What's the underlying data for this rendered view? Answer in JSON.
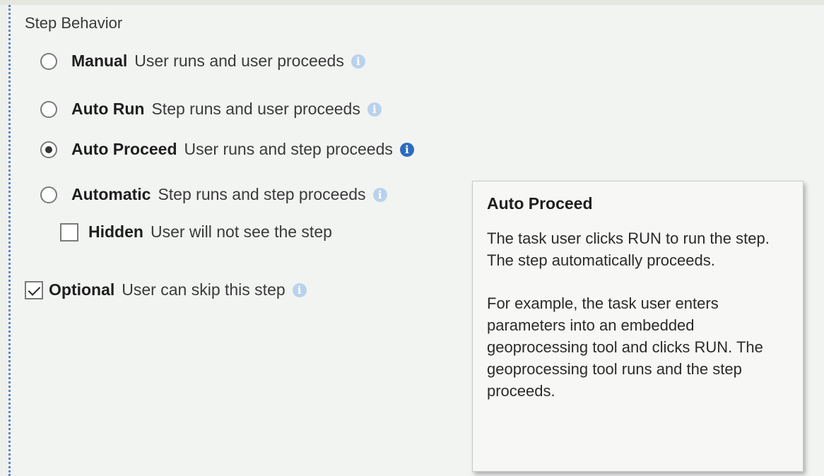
{
  "step_behavior": {
    "title": "Step Behavior",
    "options": [
      {
        "label": "Manual",
        "description": "User runs and user proceeds",
        "selected": false,
        "info_icon": "info-icon"
      },
      {
        "label": "Auto Run",
        "description": "Step runs and user proceeds",
        "selected": false,
        "info_icon": "info-icon"
      },
      {
        "label": "Auto Proceed",
        "description": "User runs and step proceeds",
        "selected": true,
        "info_icon": "info-icon"
      },
      {
        "label": "Automatic",
        "description": "Step runs and step proceeds",
        "selected": false,
        "info_icon": "info-icon"
      }
    ],
    "hidden": {
      "label": "Hidden",
      "description": "User will not see the step",
      "checked": false
    }
  },
  "optional": {
    "label": "Optional",
    "description": "User can skip this step",
    "checked": true,
    "info_icon": "info-icon"
  },
  "tooltip": {
    "title": "Auto Proceed",
    "paragraphs": [
      "The task user clicks RUN to run the step. The step automatically proceeds.",
      "For example, the task user enters parameters into an embedded geoprocessing tool and clicks RUN. The geoprocessing tool runs and the step proceeds."
    ]
  },
  "colors": {
    "background": "#f2f4f2",
    "accent_border": "#5a86c9",
    "info_active": "#2d6bc0",
    "info_inactive": "#b9d2ec"
  }
}
